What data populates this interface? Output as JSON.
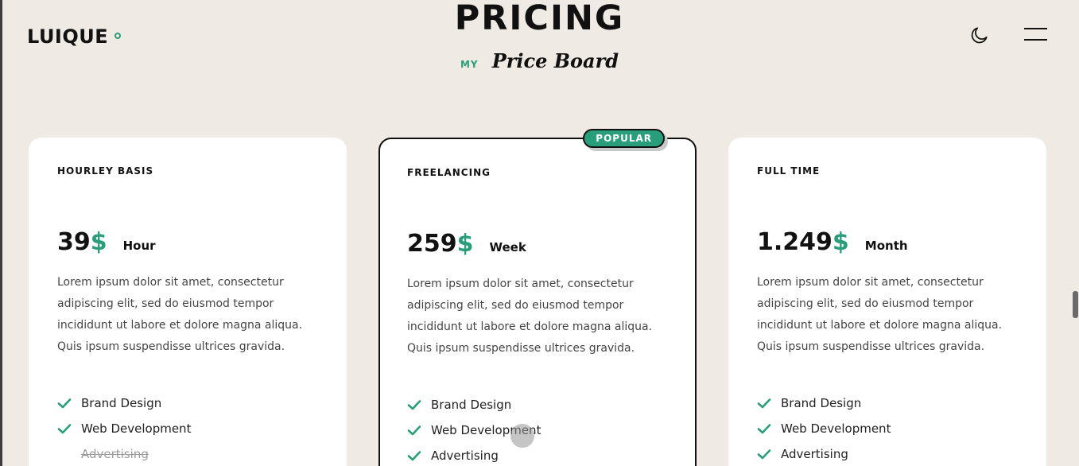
{
  "brand": {
    "logo_text": "LUIQUE"
  },
  "header": {
    "title": "PRICING",
    "subtitle_small": "MY",
    "subtitle_script": "Price Board"
  },
  "colors": {
    "accent": "#2a9d7a",
    "background": "#efeae3",
    "card": "#ffffff",
    "text": "#111111"
  },
  "icons": {
    "theme_toggle": "moon-icon",
    "menu": "hamburger-icon",
    "feature": "check-icon"
  },
  "plans": [
    {
      "name": "HOURLEY BASIS",
      "price": "39",
      "currency": "$",
      "period": "Hour",
      "description": "Lorem ipsum dolor sit amet, consectetur adipiscing elit, sed do eiusmod tempor incididunt ut labore et dolore magna aliqua. Quis ipsum suspendisse ultrices gravida.",
      "features": [
        {
          "label": "Brand Design",
          "included": true
        },
        {
          "label": "Web Development",
          "included": true
        },
        {
          "label": "Advertising",
          "included": false
        }
      ]
    },
    {
      "name": "FREELANCING",
      "badge": "POPULAR",
      "price": "259",
      "currency": "$",
      "period": "Week",
      "description": "Lorem ipsum dolor sit amet, consectetur adipiscing elit, sed do eiusmod tempor incididunt ut labore et dolore magna aliqua. Quis ipsum suspendisse ultrices gravida.",
      "features": [
        {
          "label": "Brand Design",
          "included": true
        },
        {
          "label": "Web Development",
          "included": true
        },
        {
          "label": "Advertising",
          "included": true
        }
      ]
    },
    {
      "name": "FULL TIME",
      "price": "1.249",
      "currency": "$",
      "period": "Month",
      "description": "Lorem ipsum dolor sit amet, consectetur adipiscing elit, sed do eiusmod tempor incididunt ut labore et dolore magna aliqua. Quis ipsum suspendisse ultrices gravida.",
      "features": [
        {
          "label": "Brand Design",
          "included": true
        },
        {
          "label": "Web Development",
          "included": true
        },
        {
          "label": "Advertising",
          "included": true
        }
      ]
    }
  ]
}
